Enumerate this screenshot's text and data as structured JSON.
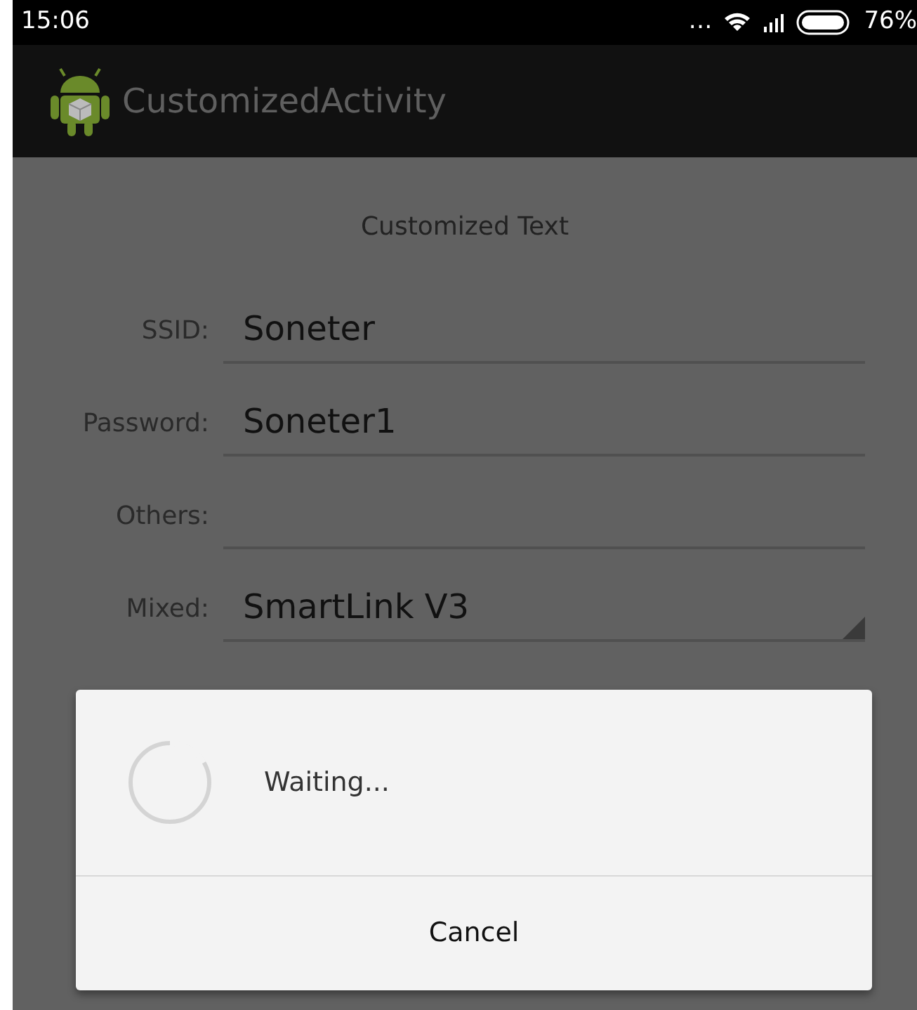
{
  "status_bar": {
    "time": "15:06",
    "dots": "…",
    "battery_text": "76%"
  },
  "app_bar": {
    "title": "CustomizedActivity"
  },
  "heading": "Customized Text",
  "fields": [
    {
      "kind": "text",
      "label": "SSID:",
      "value": "Soneter"
    },
    {
      "kind": "text",
      "label": "Password:",
      "value": "Soneter1"
    },
    {
      "kind": "text",
      "label": "Others:"
    },
    {
      "kind": "spinner",
      "label": "Mixed:",
      "value": "SmartLink V3"
    }
  ],
  "dialog": {
    "message": "Waiting...",
    "button": "Cancel"
  }
}
